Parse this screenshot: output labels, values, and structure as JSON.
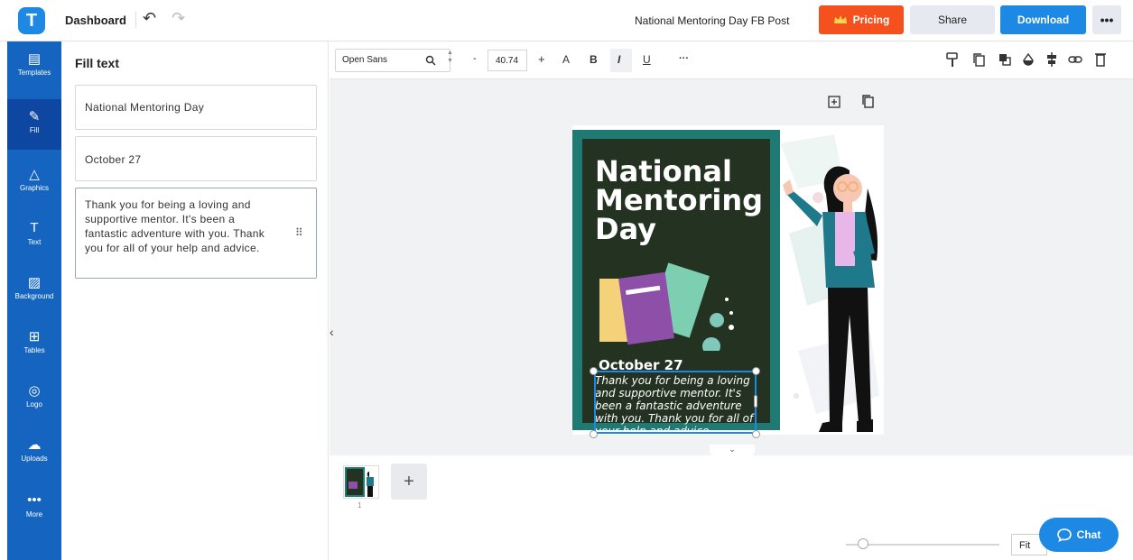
{
  "header": {
    "logo_letter": "T",
    "dashboard_label": "Dashboard",
    "undo_icon": "↶",
    "redo_icon": "↷",
    "doc_title": "National Mentoring Day FB Post",
    "pricing_label": "Pricing",
    "share_label": "Share",
    "download_label": "Download",
    "more_label": "•••"
  },
  "sidebar": {
    "items": [
      {
        "label": "Templates",
        "icon": "▤"
      },
      {
        "label": "Fill",
        "icon": "✎"
      },
      {
        "label": "Graphics",
        "icon": "△"
      },
      {
        "label": "Text",
        "icon": "T"
      },
      {
        "label": "Background",
        "icon": "▨"
      },
      {
        "label": "Tables",
        "icon": "⊞"
      },
      {
        "label": "Logo",
        "icon": "◎"
      },
      {
        "label": "Uploads",
        "icon": "☁"
      },
      {
        "label": "More",
        "icon": "•••"
      }
    ]
  },
  "panel": {
    "title": "Fill text",
    "fields": [
      "National Mentoring Day",
      "October 27",
      "Thank you for being a loving and supportive mentor. It's been a fantastic adventure with you. Thank you for all of your help and advice."
    ],
    "drag_icon": "⠿"
  },
  "toolbar": {
    "font": "Open Sans",
    "search_icon": "🔍",
    "minus": "-",
    "size": "40.74",
    "plus": "+",
    "case": "A",
    "bold": "B",
    "italic": "I",
    "underline": "U",
    "more": "···"
  },
  "design": {
    "title": "National Mentoring Day",
    "date": "October 27",
    "message": "Thank you for being a loving and supportive mentor. It's been a fantastic adventure with you. Thank you for all of your help and advice.",
    "colors": {
      "frame": "#1e7a72",
      "board": "#243321",
      "book_yellow": "#f3d27a",
      "book_purple": "#8d4fa8",
      "book_green": "#7ccfb0"
    }
  },
  "pages": {
    "add_label": "+",
    "current": "1"
  },
  "footer": {
    "fit_label": "Fit",
    "chat_label": "Chat"
  },
  "colors": {
    "accent": "#1e88e5",
    "pricing": "#f4511e",
    "sidebar": "#1565c0"
  }
}
